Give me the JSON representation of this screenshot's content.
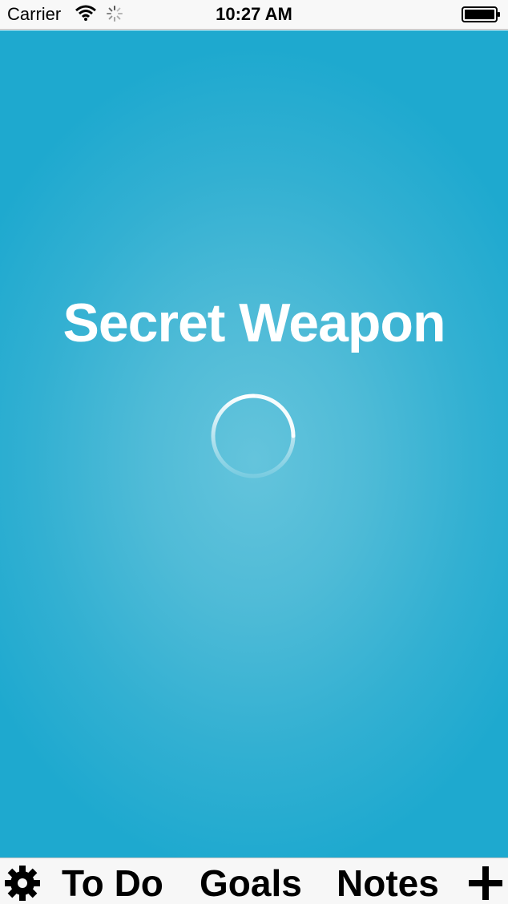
{
  "status_bar": {
    "carrier": "Carrier",
    "time": "10:27 AM",
    "icons": [
      "wifi-icon",
      "activity-icon",
      "battery-icon"
    ]
  },
  "splash": {
    "title": "Secret Weapon",
    "loading_indicator": "spinner-icon",
    "background_color": "#32b0d2",
    "title_color": "#ffffff"
  },
  "toolbar": {
    "settings_icon": "gear-icon",
    "tabs": [
      "To Do",
      "Goals",
      "Notes"
    ],
    "add_icon": "plus-icon"
  }
}
